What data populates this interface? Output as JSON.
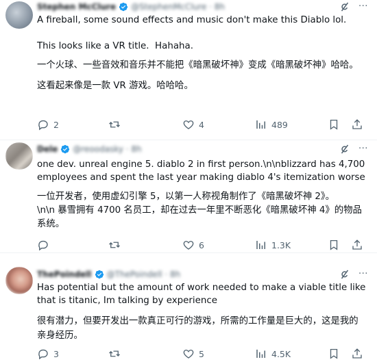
{
  "tweets": [
    {
      "author_name": "Stephen McClure",
      "author_handle": "@StephenMcClure · 8h",
      "text_en_1": "A fireball, some sound effects and music don't make this Diablo lol.",
      "text_en_2": "This looks like a VR title.  Hahaha.",
      "text_zh_1": "一个火球、一些音效和音乐并不能把《暗黑破坏神》变成《暗黑破坏神》哈哈。",
      "text_zh_2": "这看起来像是一款 VR 游戏。哈哈哈。",
      "replies": "2",
      "reposts": "",
      "likes": "4",
      "views": "489"
    },
    {
      "author_name": "Dele",
      "author_handle": "@reoodasky · 8h",
      "text_en_1": "one dev. unreal engine 5. diablo 2 in first person.\\n\\nblizzard has 4,700 employees and spent the last year making diablo 4's itemization worse",
      "text_zh_1": "一位开发者，使用虚幻引擎 5，以第一人称视角制作了《暗黑破坏神 2》。\n\\n\\n 暴雪拥有 4700 名员工，却在过去一年里不断恶化《暗黑破坏神 4》的物品系统。",
      "replies": "",
      "reposts": "",
      "likes": "6",
      "views": "1.3K"
    },
    {
      "author_name": "ThePoindell",
      "author_handle": "@ThePoindell · 8h",
      "text_en_1": "Has potential but the amount of work needed to make a viable title like that is titanic, Im talking by experience",
      "text_zh_1": "很有潜力，但要开发出一款真正可行的游戏，所需的工作量是巨大的，这是我的亲身经历。",
      "replies": "3",
      "reposts": "",
      "likes": "5",
      "views": "4.5K"
    }
  ],
  "icons": {
    "reply": "reply-icon",
    "repost": "repost-icon",
    "like": "like-icon",
    "views": "views-icon",
    "bookmark": "bookmark-icon",
    "share": "share-icon",
    "grok": "grok-icon",
    "more": "more-icon",
    "verified": "verified-badge-icon"
  },
  "colors": {
    "text": "#0f1419",
    "muted": "#536471",
    "verified": "#1d9bf0",
    "divider": "#eff3f4"
  }
}
